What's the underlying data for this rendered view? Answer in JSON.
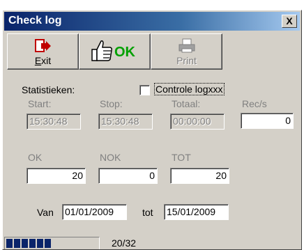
{
  "window": {
    "title": "Check log",
    "close_glyph": "X"
  },
  "toolbar": {
    "exit_label": "Exit",
    "ok_label": "OK",
    "print_label": "Print"
  },
  "stats": {
    "heading": "Statistieken:",
    "checkbox_label": "Controle logxxx",
    "checkbox_checked": false,
    "start_label": "Start:",
    "stop_label": "Stop:",
    "totaal_label": "Totaal:",
    "recs_label": "Rec/s",
    "start_value": "15:30:48",
    "stop_value": "15:30:48",
    "totaal_value": "00:00:00",
    "recs_value": "0",
    "ok_label": "OK",
    "nok_label": "NOK",
    "tot_label": "TOT",
    "ok_value": "20",
    "nok_value": "0",
    "tot_value": "20"
  },
  "period": {
    "van_label": "Van",
    "van_value": "01/01/2009",
    "tot_label": "tot",
    "tot_value": "15/01/2009"
  },
  "status": {
    "progress_text": "20/32",
    "progress_fraction": 0.625,
    "progress_color": "#0a246a"
  },
  "icons": {
    "exit": "exit-door-icon",
    "ok": "thumbs-up-icon",
    "print": "printer-icon"
  }
}
